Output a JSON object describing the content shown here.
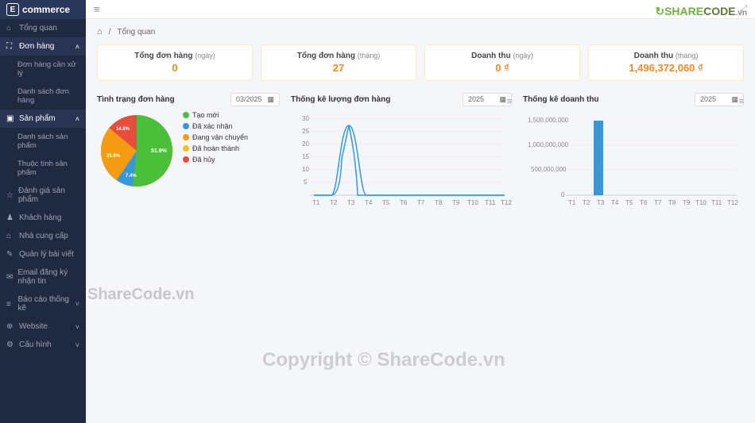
{
  "brand": {
    "name": "commerce",
    "badge": "E"
  },
  "sidebar": {
    "items": [
      {
        "label": "Tổng quan",
        "icon": "⌂"
      },
      {
        "label": "Đơn hàng",
        "icon": "⛶",
        "expanded": true,
        "children": [
          {
            "label": "Đơn hàng cần xử lý"
          },
          {
            "label": "Danh sách đơn hàng"
          }
        ]
      },
      {
        "label": "Sản phẩm",
        "icon": "▣",
        "expanded": true,
        "children": [
          {
            "label": "Danh sách sản phẩm"
          },
          {
            "label": "Thuộc tính sản phẩm"
          }
        ]
      },
      {
        "label": "Đánh giá sản phẩm",
        "icon": "☆"
      },
      {
        "label": "Khách hàng",
        "icon": "♟"
      },
      {
        "label": "Nhà cung cấp",
        "icon": "⌂"
      },
      {
        "label": "Quản lý bài viết",
        "icon": "✎"
      },
      {
        "label": "Email đăng ký nhận tin",
        "icon": "✉"
      },
      {
        "label": "Báo cáo thống kê",
        "icon": "≡"
      },
      {
        "label": "Website",
        "icon": "⊕"
      },
      {
        "label": "Cấu hình",
        "icon": "⚙"
      }
    ]
  },
  "breadcrumb": {
    "home": "⌂",
    "current": "Tổng quan"
  },
  "stats": [
    {
      "label": "Tổng đơn hàng",
      "sub": "(ngày)",
      "value": "0"
    },
    {
      "label": "Tổng đơn hàng",
      "sub": "(tháng)",
      "value": "27"
    },
    {
      "label": "Doanh thu",
      "sub": "(ngày)",
      "value": "0 ₫"
    },
    {
      "label": "Doanh thu",
      "sub": "(tháng)",
      "value": "1,496,372,060 ₫"
    }
  ],
  "pie": {
    "title": "Tình trạng đơn hàng",
    "date": "03/2025",
    "legend": [
      {
        "label": "Tạo mới",
        "color": "#4bbf3a"
      },
      {
        "label": "Đã xác nhận",
        "color": "#3498db"
      },
      {
        "label": "Đang vận chuyển",
        "color": "#f39c12"
      },
      {
        "label": "Đã hoàn thành",
        "color": "#f1c40f"
      },
      {
        "label": "Đã hủy",
        "color": "#e74c3c"
      }
    ]
  },
  "line": {
    "title": "Thống kê lượng đơn hàng",
    "year": "2025"
  },
  "bar": {
    "title": "Thống kê doanh thu",
    "year": "2025"
  },
  "watermarks": {
    "w1": "ShareCode.vn",
    "w2": "Copyright © ShareCode.vn"
  },
  "chart_data": [
    {
      "type": "pie",
      "title": "Tình trạng đơn hàng",
      "series": [
        {
          "name": "Tạo mới",
          "value": 51.9,
          "color": "#4bbf3a"
        },
        {
          "name": "Đã xác nhận",
          "value": 7.4,
          "color": "#3498db"
        },
        {
          "name": "Đang vận chuyển",
          "value": 25.9,
          "color": "#f39c12"
        },
        {
          "name": "Đã hủy",
          "value": 14.8,
          "color": "#e74c3c"
        }
      ],
      "labels_shown": [
        "51.9%",
        "7.4%",
        "25.9%",
        "14.8%"
      ]
    },
    {
      "type": "line",
      "title": "Thống kê lượng đơn hàng",
      "categories": [
        "T1",
        "T2",
        "T3",
        "T4",
        "T5",
        "T6",
        "T7",
        "T8",
        "T9",
        "T10",
        "T11",
        "T12"
      ],
      "values": [
        0,
        0,
        27,
        0,
        0,
        0,
        0,
        0,
        0,
        0,
        0,
        0
      ],
      "xlabel": "",
      "ylabel": "",
      "ylim": [
        0,
        30
      ],
      "yticks": [
        5,
        10,
        15,
        20,
        25,
        30
      ]
    },
    {
      "type": "bar",
      "title": "Thống kê doanh thu",
      "categories": [
        "T1",
        "T2",
        "T3",
        "T4",
        "T5",
        "T6",
        "T7",
        "T8",
        "T9",
        "T10",
        "T11",
        "T12"
      ],
      "values": [
        0,
        0,
        1496372060,
        0,
        0,
        0,
        0,
        0,
        0,
        0,
        0,
        0
      ],
      "xlabel": "",
      "ylabel": "",
      "ylim": [
        0,
        1500000000
      ],
      "yticks": [
        500000000,
        1000000000,
        1500000000
      ],
      "ytick_labels": [
        "500,000,000",
        "1,000,000,000",
        "1,500,000,000"
      ]
    }
  ]
}
